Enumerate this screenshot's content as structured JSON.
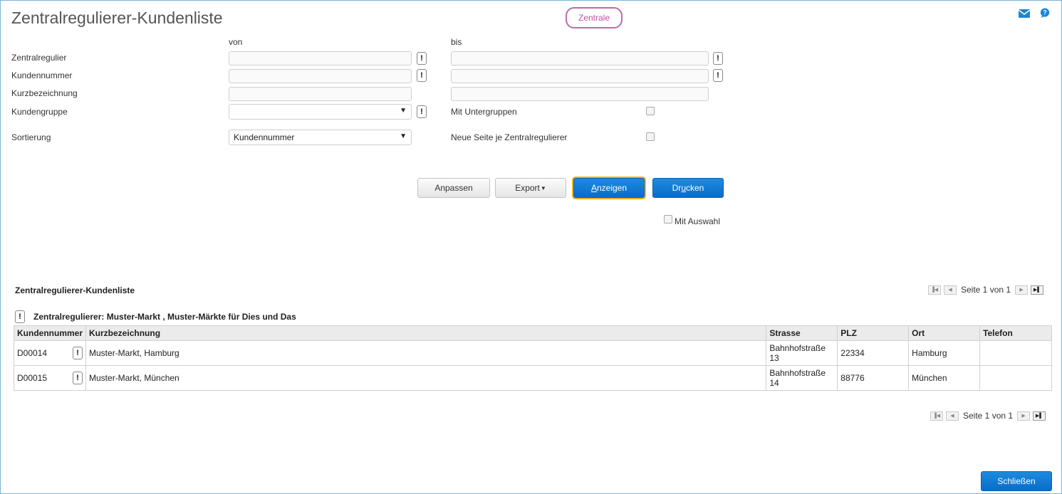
{
  "header": {
    "title": "Zentralregulierer-Kundenliste",
    "badge": "Zentrale",
    "mail_icon": "mail-icon",
    "help_icon": "help-icon",
    "accent": "#0a6cc8"
  },
  "form": {
    "col_from": "von",
    "col_to": "bis",
    "zentralregulier_label": "Zentralregulier",
    "kundennummer_label": "Kundennummer",
    "kurzbezeichnung_label": "Kurzbezeichnung",
    "kundengruppe_label": "Kundengruppe",
    "sortierung_label": "Sortierung",
    "sortierung_value": "Kundennummer",
    "kundengruppe_value": "",
    "mit_untergruppen_label": "Mit Untergruppen",
    "neue_seite_label": "Neue Seite je Zentralregulierer",
    "excl": "!"
  },
  "buttons": {
    "anpassen": "Anpassen",
    "export": "Export",
    "anzeigen_u": "A",
    "anzeigen_rest": "nzeigen",
    "drucken_a": "Dr",
    "drucken_u": "u",
    "drucken_b": "cken",
    "mit_auswahl": "Mit Auswahl",
    "schliessen": "Schließen"
  },
  "report": {
    "title": "Zentralregulierer-Kundenliste",
    "pager_text": "Seite 1 von 1",
    "group_title": "Zentralregulierer: Muster-Markt , Muster-Märkte für Dies und Das",
    "columns": [
      "Kundennummer",
      "Kurzbezeichnung",
      "Strasse",
      "PLZ",
      "Ort",
      "Telefon"
    ],
    "rows": [
      {
        "kundennummer": "D00014",
        "kurzbezeichnung": "Muster-Markt, Hamburg",
        "strasse_1": "Bahnhofstraße",
        "strasse_2": "13",
        "plz": "22334",
        "ort": "Hamburg",
        "telefon": ""
      },
      {
        "kundennummer": "D00015",
        "kurzbezeichnung": "Muster-Markt, München",
        "strasse_1": "Bahnhofstraße",
        "strasse_2": "14",
        "plz": "88776",
        "ort": "München",
        "telefon": ""
      }
    ]
  }
}
